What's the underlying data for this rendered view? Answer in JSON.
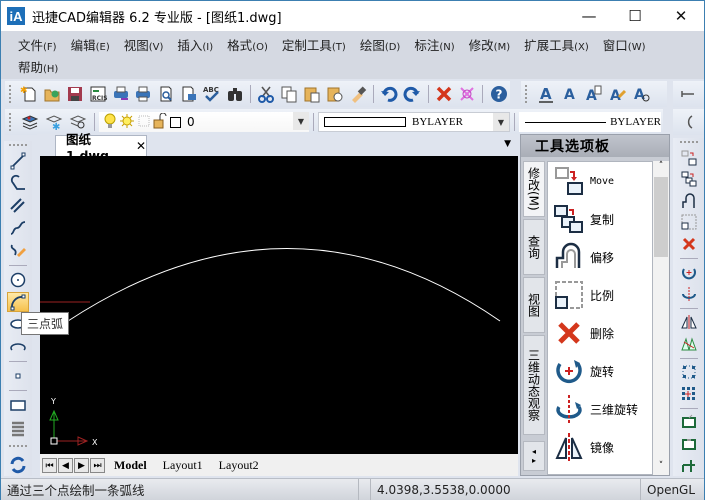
{
  "window": {
    "title": "迅捷CAD编辑器 6.2 专业版  - [图纸1.dwg]",
    "app_icon": "iA",
    "controls": {
      "minimize": "—",
      "maximize": "☐",
      "close": "✕"
    }
  },
  "menubar": {
    "row1": [
      {
        "label": "文件",
        "accel": "(F)"
      },
      {
        "label": "编辑",
        "accel": "(E)"
      },
      {
        "label": "视图",
        "accel": "(V)"
      },
      {
        "label": "插入",
        "accel": "(I)"
      },
      {
        "label": "格式",
        "accel": "(O)"
      },
      {
        "label": "定制工具",
        "accel": "(T)"
      },
      {
        "label": "绘图",
        "accel": "(D)"
      },
      {
        "label": "标注",
        "accel": "(N)"
      },
      {
        "label": "修改",
        "accel": "(M)"
      },
      {
        "label": "扩展工具",
        "accel": "(X)"
      },
      {
        "label": "窗口",
        "accel": "(W)"
      }
    ],
    "row2": [
      {
        "label": "帮助",
        "accel": "(H)"
      }
    ]
  },
  "standard_toolbar": {
    "icons": [
      "new-icon",
      "open-icon",
      "save-icon",
      "export-icon",
      "print-to-icon",
      "print-icon",
      "print-preview-icon",
      "page-setup-icon",
      "spellcheck-icon",
      "find-icon",
      "cut-icon",
      "copy-icon",
      "paste-icon",
      "paste-special-icon",
      "match-properties-icon",
      "undo-icon",
      "redo-icon",
      "delete-icon",
      "purge-icon",
      "help-icon"
    ],
    "spellcheck_text": "ABC"
  },
  "text_toolbar": {
    "icons": [
      "text-icon",
      "mtext-icon",
      "edit-text-icon",
      "text-style-icon",
      "find-text-icon"
    ]
  },
  "layer_toolbar": {
    "layer_value": "0",
    "color_value": "BYLAYER",
    "linetype_value": "BYLAYER"
  },
  "doc_tab": {
    "label": "图纸1.dwg",
    "close": "✕"
  },
  "layout_tabs": [
    {
      "label": "Model",
      "active": true
    },
    {
      "label": "Layout1",
      "active": false
    },
    {
      "label": "Layout2",
      "active": false
    }
  ],
  "tooltip": "三点弧",
  "canvas": {
    "ucs_x_label": "X",
    "ucs_y_label": "Y",
    "background": "#000000",
    "curve_color": "#ffffff"
  },
  "palette": {
    "title": "工具选项板",
    "side_tabs": [
      {
        "label": "修改(M)",
        "active": true
      },
      {
        "label": "查询",
        "active": false
      },
      {
        "label": "视图",
        "active": false
      },
      {
        "label": "三维动态观察",
        "active": false
      }
    ],
    "items": [
      {
        "label": "Move",
        "icon": "move-icon"
      },
      {
        "label": "复制",
        "icon": "copy-icon"
      },
      {
        "label": "偏移",
        "icon": "offset-icon"
      },
      {
        "label": "比例",
        "icon": "scale-icon"
      },
      {
        "label": "删除",
        "icon": "erase-icon"
      },
      {
        "label": "旋转",
        "icon": "rotate-icon"
      },
      {
        "label": "三维旋转",
        "icon": "rotate3d-icon"
      },
      {
        "label": "镜像",
        "icon": "mirror-icon"
      }
    ]
  },
  "statusbar": {
    "message": "通过三个点绘制一条弧线",
    "coordinates": "4.0398,3.5538,0.0000",
    "renderer": "OpenGL"
  },
  "colors": {
    "accent": "#1d6fb8",
    "erase": "#d4371c",
    "active_tool": "#f6c14e"
  }
}
